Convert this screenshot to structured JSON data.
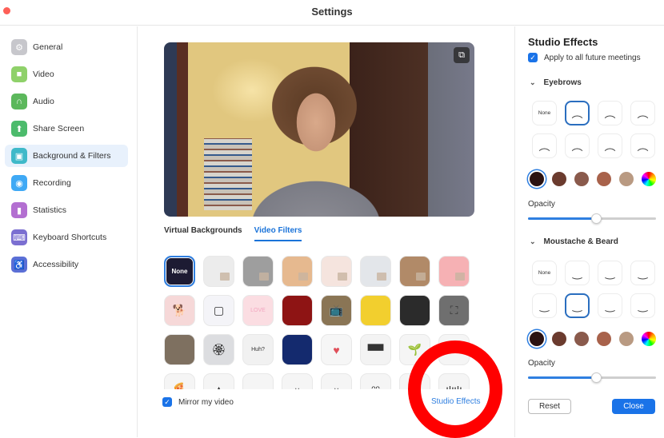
{
  "window": {
    "title": "Settings"
  },
  "sidebar": {
    "items": [
      {
        "label": "General",
        "icon": "gear-icon",
        "color": "#c7c7cc",
        "glyph": "⚙"
      },
      {
        "label": "Video",
        "icon": "video-camera-icon",
        "color": "#8fd16a",
        "glyph": "■"
      },
      {
        "label": "Audio",
        "icon": "headphones-icon",
        "color": "#5cb85c",
        "glyph": "∩"
      },
      {
        "label": "Share Screen",
        "icon": "share-screen-icon",
        "color": "#4cbb6c",
        "glyph": "⬆"
      },
      {
        "label": "Background & Filters",
        "icon": "background-icon",
        "color": "#3fb9c9",
        "glyph": "▣",
        "active": true
      },
      {
        "label": "Recording",
        "icon": "recording-icon",
        "color": "#3fa9f5",
        "glyph": "◉"
      },
      {
        "label": "Statistics",
        "icon": "statistics-icon",
        "color": "#b36fd1",
        "glyph": "▮"
      },
      {
        "label": "Keyboard Shortcuts",
        "icon": "keyboard-icon",
        "color": "#7b6fd1",
        "glyph": "⌨"
      },
      {
        "label": "Accessibility",
        "icon": "accessibility-icon",
        "color": "#5b6fd6",
        "glyph": "♿"
      }
    ]
  },
  "main": {
    "rotate_icon": "⧉",
    "tabs": [
      {
        "label": "Virtual Backgrounds",
        "active": false
      },
      {
        "label": "Video Filters",
        "active": true
      }
    ],
    "filters": [
      {
        "name": "None",
        "bg": "#1d1b33",
        "label": "None",
        "selected": true
      },
      {
        "name": "white-room",
        "bg": "#ececec"
      },
      {
        "name": "gray-room",
        "bg": "#9e9e9e"
      },
      {
        "name": "peach-room",
        "bg": "#e6b98f"
      },
      {
        "name": "blush-room",
        "bg": "#f5e4de"
      },
      {
        "name": "cool-room",
        "bg": "#e3e6ea"
      },
      {
        "name": "tan-room",
        "bg": "#b18a68"
      },
      {
        "name": "pink-room",
        "bg": "#f6b1b4"
      },
      {
        "name": "corgi",
        "bg": "#f6d8d8",
        "glyph": "🐕"
      },
      {
        "name": "frame-hearts",
        "bg": "#f4f4f8",
        "glyph": "▢"
      },
      {
        "name": "love",
        "bg": "#fbdde2",
        "glyph": "LOVE"
      },
      {
        "name": "theater",
        "bg": "#8e1414"
      },
      {
        "name": "retro-tv",
        "bg": "#8a7555",
        "glyph": "📺"
      },
      {
        "name": "emoji-frame",
        "bg": "#f2cf2e"
      },
      {
        "name": "flower-frame",
        "bg": "#2b2b2b"
      },
      {
        "name": "focus-frame",
        "bg": "#6f6f6f",
        "glyph": "⛶"
      },
      {
        "name": "old-tv",
        "bg": "#7e7060"
      },
      {
        "name": "ribbon",
        "bg": "#dcdde0",
        "glyph": "🏵"
      },
      {
        "name": "huh-bubble",
        "bg": "#f1f1f1",
        "glyph": "Huh?"
      },
      {
        "name": "string-lights",
        "bg": "#142a6e"
      },
      {
        "name": "heart-sticker",
        "bg": "#f6f6f6",
        "glyph": "♥"
      },
      {
        "name": "sunglasses",
        "bg": "#f3f3f3",
        "glyph": "▀▀"
      },
      {
        "name": "sprout",
        "bg": "#f5f5f5",
        "glyph": "🌱"
      },
      {
        "name": "blank",
        "bg": "#f5f5f5"
      },
      {
        "name": "pizza",
        "bg": "#f5f5f5",
        "glyph": "🍕"
      },
      {
        "name": "hat",
        "bg": "#f5f5f5",
        "glyph": "▲"
      },
      {
        "name": "halo",
        "bg": "#f5f5f5"
      },
      {
        "name": "mask",
        "bg": "#f5f5f5",
        "glyph": "ᵕ"
      },
      {
        "name": "face-mask",
        "bg": "#f5f5f5",
        "glyph": "ᵕ"
      },
      {
        "name": "bunny-ears",
        "bg": "#f5f5f5",
        "glyph": "ᵔᵔ"
      },
      {
        "name": "bear-ears",
        "bg": "#f5f5f5",
        "glyph": "●●"
      },
      {
        "name": "antlers",
        "bg": "#f5f5f5",
        "glyph": "ψψ"
      }
    ],
    "mirror": {
      "label": "Mirror my video",
      "checked": true
    },
    "studio_effects_link": "Studio Effects"
  },
  "panel": {
    "title": "Studio Effects",
    "apply_label": "Apply to all future meetings",
    "apply_checked": true,
    "eyebrows": {
      "heading": "Eyebrows",
      "options": [
        "None",
        "brow-1",
        "brow-2",
        "brow-3",
        "brow-4",
        "brow-5",
        "brow-6",
        "brow-7"
      ],
      "selected_index": 1,
      "colors": [
        "#2a1212",
        "#6b3b2e",
        "#8a5a4c",
        "#a8624b",
        "#b99a82",
        "rainbow"
      ],
      "selected_color": 0,
      "opacity_label": "Opacity",
      "opacity": 0.53
    },
    "moustache": {
      "heading": "Moustache & Beard",
      "options": [
        "None",
        "full-beard",
        "goatee",
        "chin-strap",
        "handlebar",
        "chevron-soul-patch",
        "thin",
        "bushy"
      ],
      "selected_index": 5,
      "colors": [
        "#2a1212",
        "#6b3b2e",
        "#8a5a4c",
        "#a8624b",
        "#b99a82",
        "rainbow"
      ],
      "selected_color": 0,
      "opacity_label": "Opacity",
      "opacity": 0.53
    },
    "reset_label": "Reset",
    "close_label": "Close"
  }
}
